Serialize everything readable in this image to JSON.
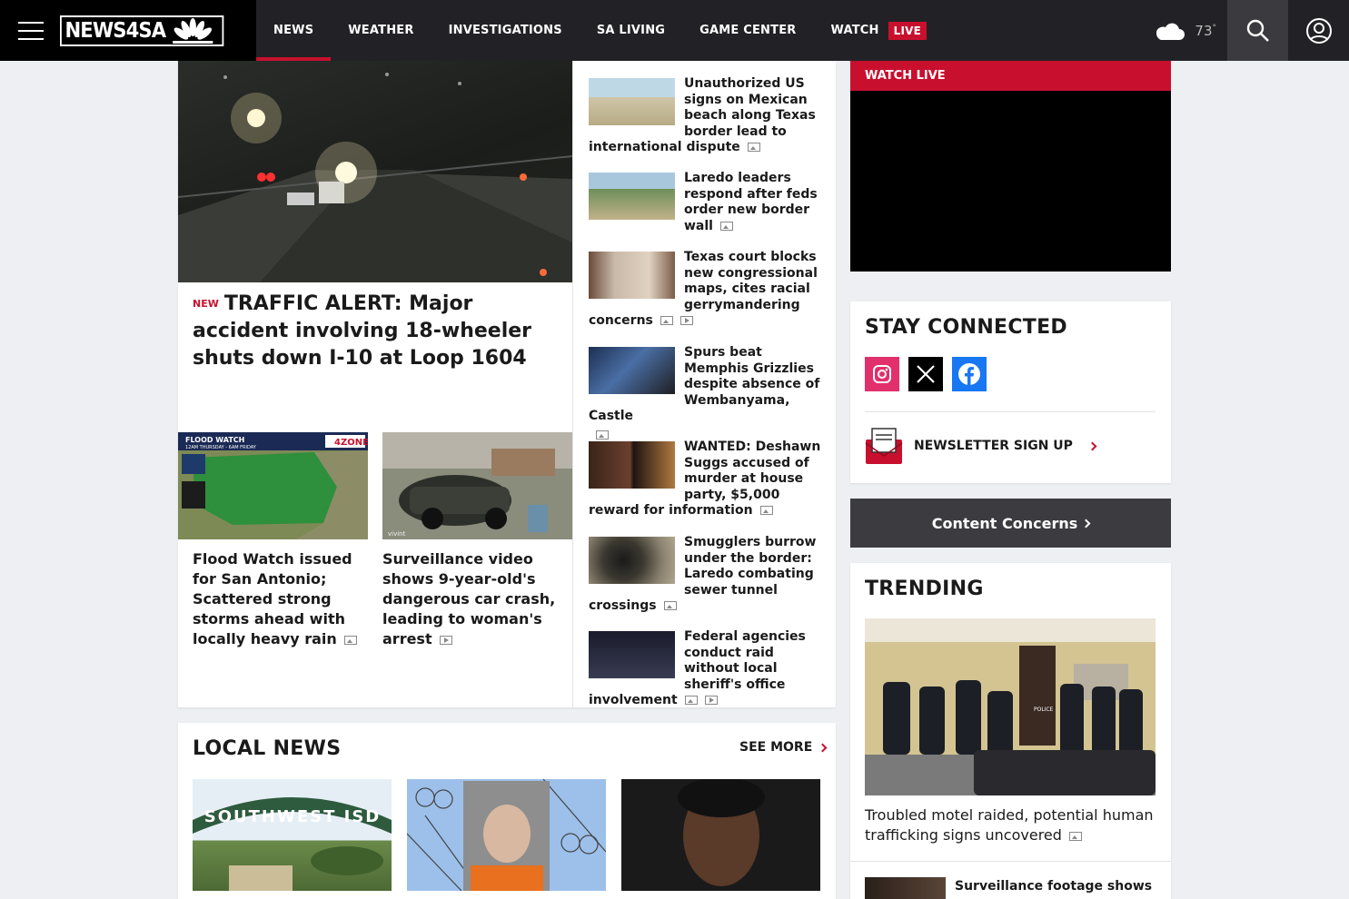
{
  "header": {
    "logo_text": "NEWS4SA",
    "nav": [
      {
        "label": "NEWS"
      },
      {
        "label": "WEATHER"
      },
      {
        "label": "INVESTIGATIONS"
      },
      {
        "label": "SA LIVING"
      },
      {
        "label": "GAME CENTER"
      },
      {
        "label": "WATCH"
      }
    ],
    "live_badge": "LIVE",
    "temperature": "73",
    "degree": "°"
  },
  "hero": {
    "tag": "NEW",
    "title": "TRAFFIC ALERT: Major accident involving 18-wheeler shuts down I-10 at Loop 1604"
  },
  "sub_stories": [
    {
      "title": "Flood Watch issued for San Antonio; Scattered strong storms ahead with locally heavy rain",
      "overlay_title": "FLOOD WATCH",
      "overlay_sub": "12AM THURSDAY - 6AM FRIDAY",
      "overlay_brand": "4ZONE"
    },
    {
      "title": "Surveillance video shows 9-year-old's dangerous car crash, leading to woman's arrest",
      "overlay_brand": "vivint"
    }
  ],
  "side_stories": [
    {
      "title": "Unauthorized US signs on Mexican beach along Texas border lead to international dispute"
    },
    {
      "title": "Laredo leaders respond after feds order new border wall"
    },
    {
      "title": "Texas court blocks new congressional maps, cites racial gerrymandering concerns"
    },
    {
      "title": "Spurs beat Memphis Grizzlies despite absence of Wembanyama, Castle"
    },
    {
      "title": "WANTED: Deshawn Suggs accused of murder at house party, $5,000 reward for information"
    },
    {
      "title": "Smugglers burrow under the border: Laredo combating sewer tunnel crossings"
    },
    {
      "title": "Federal agencies conduct raid without local sheriff's office involvement"
    }
  ],
  "local_news": {
    "heading": "LOCAL NEWS",
    "see_more": "SEE MORE",
    "sign_text": "SOUTHWEST ISD"
  },
  "sidebar": {
    "watch_live": "WATCH LIVE",
    "stay_connected": "STAY CONNECTED",
    "newsletter": "NEWSLETTER SIGN UP",
    "content_concerns": "Content Concerns",
    "trending_heading": "TRENDING",
    "trending_main": "Troubled motel raided, potential human trafficking signs uncovered",
    "trending_next": "Surveillance footage shows",
    "police_label": "POLICE"
  },
  "colors": {
    "accent_red": "#c8102e",
    "topbar": "#222226",
    "instagram": "#e1306c",
    "facebook": "#1877f2"
  },
  "icons": [
    "menu-icon",
    "nbc-peacock-icon",
    "cloud-icon",
    "search-icon",
    "account-icon",
    "instagram-icon",
    "x-icon",
    "facebook-icon",
    "newsletter-icon",
    "image-icon",
    "video-icon",
    "chevron-right-icon"
  ]
}
